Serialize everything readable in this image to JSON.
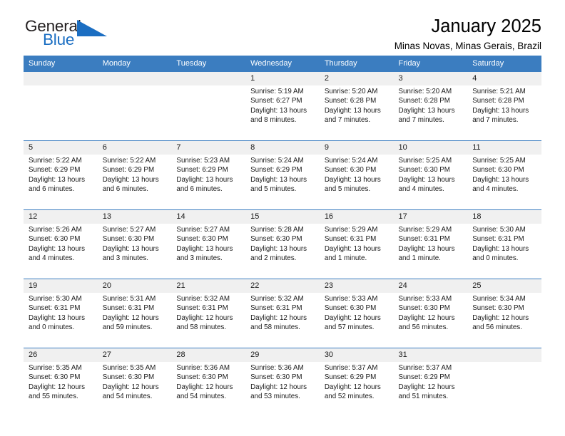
{
  "brand": {
    "name_top": "General",
    "name_bottom": "Blue",
    "accent_color": "#1b6ec2",
    "triangle_icon": "triangle-icon"
  },
  "header": {
    "title": "January 2025",
    "subtitle": "Minas Novas, Minas Gerais, Brazil"
  },
  "calendar": {
    "header_bg": "#3b7dc0",
    "daynum_bg": "#f0f0f0",
    "weekday_headers": [
      "Sunday",
      "Monday",
      "Tuesday",
      "Wednesday",
      "Thursday",
      "Friday",
      "Saturday"
    ],
    "weeks": [
      [
        {
          "day": "",
          "sunrise": "",
          "sunset": "",
          "daylight_1": "",
          "daylight_2": ""
        },
        {
          "day": "",
          "sunrise": "",
          "sunset": "",
          "daylight_1": "",
          "daylight_2": ""
        },
        {
          "day": "",
          "sunrise": "",
          "sunset": "",
          "daylight_1": "",
          "daylight_2": ""
        },
        {
          "day": "1",
          "sunrise": "Sunrise: 5:19 AM",
          "sunset": "Sunset: 6:27 PM",
          "daylight_1": "Daylight: 13 hours",
          "daylight_2": "and 8 minutes."
        },
        {
          "day": "2",
          "sunrise": "Sunrise: 5:20 AM",
          "sunset": "Sunset: 6:28 PM",
          "daylight_1": "Daylight: 13 hours",
          "daylight_2": "and 7 minutes."
        },
        {
          "day": "3",
          "sunrise": "Sunrise: 5:20 AM",
          "sunset": "Sunset: 6:28 PM",
          "daylight_1": "Daylight: 13 hours",
          "daylight_2": "and 7 minutes."
        },
        {
          "day": "4",
          "sunrise": "Sunrise: 5:21 AM",
          "sunset": "Sunset: 6:28 PM",
          "daylight_1": "Daylight: 13 hours",
          "daylight_2": "and 7 minutes."
        }
      ],
      [
        {
          "day": "5",
          "sunrise": "Sunrise: 5:22 AM",
          "sunset": "Sunset: 6:29 PM",
          "daylight_1": "Daylight: 13 hours",
          "daylight_2": "and 6 minutes."
        },
        {
          "day": "6",
          "sunrise": "Sunrise: 5:22 AM",
          "sunset": "Sunset: 6:29 PM",
          "daylight_1": "Daylight: 13 hours",
          "daylight_2": "and 6 minutes."
        },
        {
          "day": "7",
          "sunrise": "Sunrise: 5:23 AM",
          "sunset": "Sunset: 6:29 PM",
          "daylight_1": "Daylight: 13 hours",
          "daylight_2": "and 6 minutes."
        },
        {
          "day": "8",
          "sunrise": "Sunrise: 5:24 AM",
          "sunset": "Sunset: 6:29 PM",
          "daylight_1": "Daylight: 13 hours",
          "daylight_2": "and 5 minutes."
        },
        {
          "day": "9",
          "sunrise": "Sunrise: 5:24 AM",
          "sunset": "Sunset: 6:30 PM",
          "daylight_1": "Daylight: 13 hours",
          "daylight_2": "and 5 minutes."
        },
        {
          "day": "10",
          "sunrise": "Sunrise: 5:25 AM",
          "sunset": "Sunset: 6:30 PM",
          "daylight_1": "Daylight: 13 hours",
          "daylight_2": "and 4 minutes."
        },
        {
          "day": "11",
          "sunrise": "Sunrise: 5:25 AM",
          "sunset": "Sunset: 6:30 PM",
          "daylight_1": "Daylight: 13 hours",
          "daylight_2": "and 4 minutes."
        }
      ],
      [
        {
          "day": "12",
          "sunrise": "Sunrise: 5:26 AM",
          "sunset": "Sunset: 6:30 PM",
          "daylight_1": "Daylight: 13 hours",
          "daylight_2": "and 4 minutes."
        },
        {
          "day": "13",
          "sunrise": "Sunrise: 5:27 AM",
          "sunset": "Sunset: 6:30 PM",
          "daylight_1": "Daylight: 13 hours",
          "daylight_2": "and 3 minutes."
        },
        {
          "day": "14",
          "sunrise": "Sunrise: 5:27 AM",
          "sunset": "Sunset: 6:30 PM",
          "daylight_1": "Daylight: 13 hours",
          "daylight_2": "and 3 minutes."
        },
        {
          "day": "15",
          "sunrise": "Sunrise: 5:28 AM",
          "sunset": "Sunset: 6:30 PM",
          "daylight_1": "Daylight: 13 hours",
          "daylight_2": "and 2 minutes."
        },
        {
          "day": "16",
          "sunrise": "Sunrise: 5:29 AM",
          "sunset": "Sunset: 6:31 PM",
          "daylight_1": "Daylight: 13 hours",
          "daylight_2": "and 1 minute."
        },
        {
          "day": "17",
          "sunrise": "Sunrise: 5:29 AM",
          "sunset": "Sunset: 6:31 PM",
          "daylight_1": "Daylight: 13 hours",
          "daylight_2": "and 1 minute."
        },
        {
          "day": "18",
          "sunrise": "Sunrise: 5:30 AM",
          "sunset": "Sunset: 6:31 PM",
          "daylight_1": "Daylight: 13 hours",
          "daylight_2": "and 0 minutes."
        }
      ],
      [
        {
          "day": "19",
          "sunrise": "Sunrise: 5:30 AM",
          "sunset": "Sunset: 6:31 PM",
          "daylight_1": "Daylight: 13 hours",
          "daylight_2": "and 0 minutes."
        },
        {
          "day": "20",
          "sunrise": "Sunrise: 5:31 AM",
          "sunset": "Sunset: 6:31 PM",
          "daylight_1": "Daylight: 12 hours",
          "daylight_2": "and 59 minutes."
        },
        {
          "day": "21",
          "sunrise": "Sunrise: 5:32 AM",
          "sunset": "Sunset: 6:31 PM",
          "daylight_1": "Daylight: 12 hours",
          "daylight_2": "and 58 minutes."
        },
        {
          "day": "22",
          "sunrise": "Sunrise: 5:32 AM",
          "sunset": "Sunset: 6:31 PM",
          "daylight_1": "Daylight: 12 hours",
          "daylight_2": "and 58 minutes."
        },
        {
          "day": "23",
          "sunrise": "Sunrise: 5:33 AM",
          "sunset": "Sunset: 6:30 PM",
          "daylight_1": "Daylight: 12 hours",
          "daylight_2": "and 57 minutes."
        },
        {
          "day": "24",
          "sunrise": "Sunrise: 5:33 AM",
          "sunset": "Sunset: 6:30 PM",
          "daylight_1": "Daylight: 12 hours",
          "daylight_2": "and 56 minutes."
        },
        {
          "day": "25",
          "sunrise": "Sunrise: 5:34 AM",
          "sunset": "Sunset: 6:30 PM",
          "daylight_1": "Daylight: 12 hours",
          "daylight_2": "and 56 minutes."
        }
      ],
      [
        {
          "day": "26",
          "sunrise": "Sunrise: 5:35 AM",
          "sunset": "Sunset: 6:30 PM",
          "daylight_1": "Daylight: 12 hours",
          "daylight_2": "and 55 minutes."
        },
        {
          "day": "27",
          "sunrise": "Sunrise: 5:35 AM",
          "sunset": "Sunset: 6:30 PM",
          "daylight_1": "Daylight: 12 hours",
          "daylight_2": "and 54 minutes."
        },
        {
          "day": "28",
          "sunrise": "Sunrise: 5:36 AM",
          "sunset": "Sunset: 6:30 PM",
          "daylight_1": "Daylight: 12 hours",
          "daylight_2": "and 54 minutes."
        },
        {
          "day": "29",
          "sunrise": "Sunrise: 5:36 AM",
          "sunset": "Sunset: 6:30 PM",
          "daylight_1": "Daylight: 12 hours",
          "daylight_2": "and 53 minutes."
        },
        {
          "day": "30",
          "sunrise": "Sunrise: 5:37 AM",
          "sunset": "Sunset: 6:29 PM",
          "daylight_1": "Daylight: 12 hours",
          "daylight_2": "and 52 minutes."
        },
        {
          "day": "31",
          "sunrise": "Sunrise: 5:37 AM",
          "sunset": "Sunset: 6:29 PM",
          "daylight_1": "Daylight: 12 hours",
          "daylight_2": "and 51 minutes."
        },
        {
          "day": "",
          "sunrise": "",
          "sunset": "",
          "daylight_1": "",
          "daylight_2": ""
        }
      ]
    ]
  }
}
